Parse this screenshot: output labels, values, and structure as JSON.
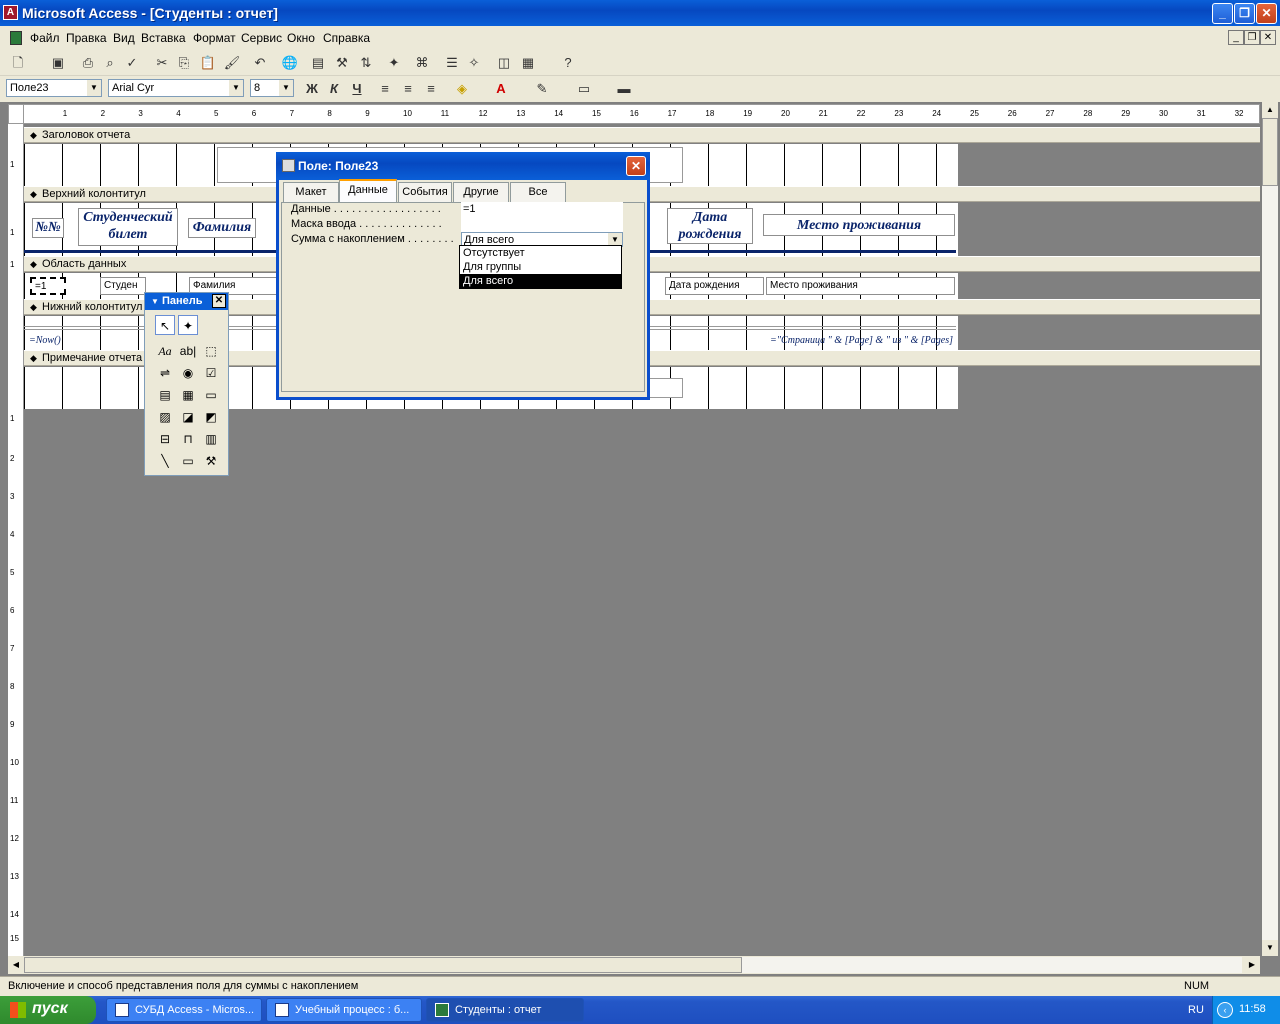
{
  "window": {
    "title": "Microsoft Access - [Студенты : отчет]"
  },
  "menu": [
    "Файл",
    "Правка",
    "Вид",
    "Вставка",
    "Формат",
    "Сервис",
    "Окно",
    "Справка"
  ],
  "format_toolbar": {
    "control_name": "Поле23",
    "font": "Arial Cyr",
    "size": "8",
    "bold": "Ж",
    "italic": "К",
    "underline": "Ч"
  },
  "ruler": [
    "1",
    "2",
    "3",
    "4",
    "5",
    "6",
    "7",
    "8",
    "9",
    "10",
    "11",
    "12",
    "13",
    "14",
    "15",
    "16",
    "17",
    "18",
    "19",
    "20",
    "21",
    "22",
    "23",
    "24",
    "25",
    "26",
    "27",
    "28",
    "29",
    "30",
    "31",
    "32"
  ],
  "vruler": [
    "1",
    "1",
    "1",
    "1",
    "2",
    "3",
    "4",
    "5",
    "6",
    "7",
    "8",
    "9",
    "10",
    "11",
    "12",
    "13",
    "14",
    "15"
  ],
  "sections": {
    "report_header": "Заголовок отчета",
    "page_header": "Верхний колонтитул",
    "detail": "Область данных",
    "page_footer": "Нижний колонтитул",
    "report_footer": "Примечание отчета"
  },
  "header_labels": {
    "num": "№№",
    "student_card": "Студенческий билет",
    "surname": "Фамилия",
    "birth": "Дата рождения",
    "address": "Место проживания"
  },
  "detail_fields": {
    "counter": "=1",
    "student": "Студен",
    "surname": "Фамилия",
    "birth": "Дата рождения",
    "address": "Место проживания"
  },
  "footer_fields": {
    "now": "=Now()",
    "pages": "=\"Страница \" & [Page] & \" из \" & [Pages]"
  },
  "dialog": {
    "title": "Поле: Поле23",
    "tabs": [
      "Макет",
      "Данные",
      "События",
      "Другие",
      "Все"
    ],
    "selected_tab": "Данные",
    "props": [
      {
        "label": "Данные . . . . . . . . . . . . . . . . . .",
        "value": "=1"
      },
      {
        "label": "Маска ввода . . . . . . . . . . . . . .",
        "value": ""
      },
      {
        "label": "Сумма с накоплением . . . . . . . .",
        "value": "Для всего"
      }
    ],
    "dropdown_options": [
      "Отсутствует",
      "Для группы",
      "Для всего"
    ],
    "dropdown_selected": "Для всего"
  },
  "toolbox": {
    "title": "Панель"
  },
  "statusbar": {
    "text": "Включение и способ представления поля для суммы с накоплением",
    "num": "NUM"
  },
  "taskbar": {
    "start": "пуск",
    "tasks": [
      "СУБД Access - Micros...",
      "Учебный процесс : б...",
      "Студенты : отчет"
    ],
    "lang": "RU",
    "clock": "11:58"
  }
}
